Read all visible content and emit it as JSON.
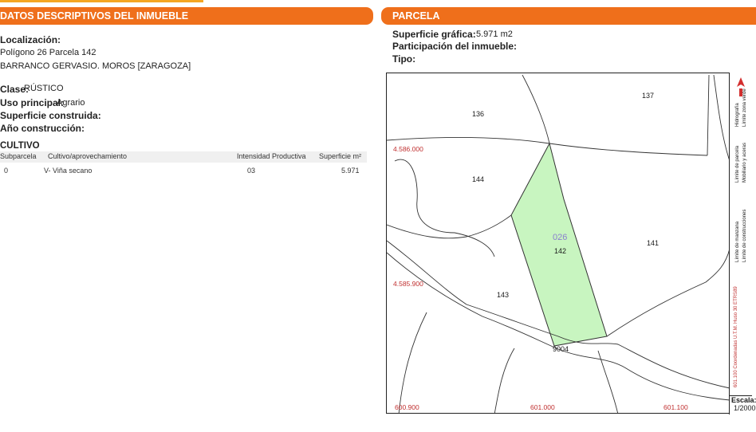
{
  "left_panel": {
    "title": "DATOS DESCRIPTIVOS DEL INMUEBLE",
    "localizacion_label": "Localización:",
    "localizacion_line1": "Polígono 26 Parcela 142",
    "localizacion_line2": "BARRANCO GERVASIO. MOROS [ZARAGOZA]",
    "clase_label": "Clase:",
    "clase_value": "RÚSTICO",
    "uso_label": "Uso principal:",
    "uso_value": "Agrario",
    "superficie_label": "Superficie construida:",
    "anio_label": "Año construcción:",
    "cultivo_title": "CULTIVO",
    "table": {
      "headers": [
        "Subparcela",
        "Cultivo/aprovechamiento",
        "Intensidad Productiva",
        "Superficie m²"
      ],
      "rows": [
        [
          "0",
          "V- Viña secano",
          "03",
          "5.971"
        ]
      ]
    }
  },
  "right_panel": {
    "title": "PARCELA",
    "superficie_label": "Superficie gráfica:",
    "superficie_value": "5.971 m2",
    "participacion_label": "Participación del inmueble:",
    "tipo_label": "Tipo:"
  },
  "map": {
    "parcel_labels": [
      "137",
      "136",
      "144",
      "141",
      "142",
      "143",
      "9004"
    ],
    "manzana_label": "026",
    "y_coords": [
      "4.586.000",
      "4.585.900"
    ],
    "x_coords": [
      "600.900",
      "601.000",
      "601.100"
    ],
    "highlight_color": "#c8f5c0",
    "legend": {
      "col1": "601.100 Coordenadas U.T.M. Huso 30 ETRS89",
      "col2a": "Límite de manzana",
      "col2b": "Límite de parcela",
      "col3a": "Límite de construcciones",
      "col3b": "Mobiliario y aceras",
      "col3c": "Hidrografía",
      "col3d": "Límite zona verde"
    },
    "scale_label": "Escala:",
    "scale_value": "1/2000"
  }
}
